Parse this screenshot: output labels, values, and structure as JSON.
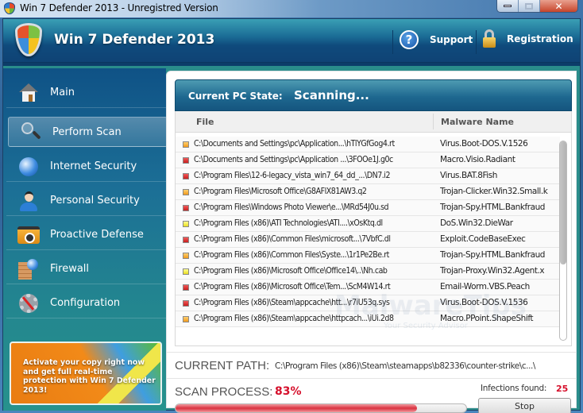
{
  "window": {
    "title": "Win 7 Defender 2013 - Unregistred Version",
    "controls": {
      "minimize": "—",
      "maximize": "□",
      "close": "✕"
    }
  },
  "header": {
    "app_title": "Win 7 Defender 2013",
    "support_label": "Support",
    "registration_label": "Registration",
    "icons": {
      "logo": "shield-icon",
      "support": "help-icon",
      "registration": "lock-icon"
    }
  },
  "sidebar": {
    "items": [
      {
        "label": "Main",
        "icon": "house-icon",
        "active": false
      },
      {
        "label": "Perform Scan",
        "icon": "magnifier-icon",
        "active": true
      },
      {
        "label": "Internet Security",
        "icon": "globe-icon",
        "active": false
      },
      {
        "label": "Personal Security",
        "icon": "person-icon",
        "active": false
      },
      {
        "label": "Proactive Defense",
        "icon": "folder-icon",
        "active": false
      },
      {
        "label": "Firewall",
        "icon": "firewall-icon",
        "active": false
      },
      {
        "label": "Configuration",
        "icon": "gear-icon",
        "active": false
      }
    ],
    "promo_text": "Activate your copy right now and get full real-time protection with Win 7 Defender 2013!"
  },
  "main": {
    "state_label": "Current PC State:",
    "state_value": "Scanning...",
    "columns": {
      "file": "File",
      "malware": "Malware Name"
    },
    "rows": [
      {
        "severity": "orange",
        "file": "C:\\Documents and Settings\\pc\\Application...\\hTlYGfGog4.rt",
        "malware": "Virus.Boot-DOS.V.1526"
      },
      {
        "severity": "red",
        "file": "C:\\Documents and Settings\\pc\\Application ...\\3FOOe1J.g0c",
        "malware": "Macro.Visio.Radiant"
      },
      {
        "severity": "red",
        "file": "C:\\Program Files\\12-6-legacy_vista_win7_64_dd_...\\DN7.i2",
        "malware": "Virus.BAT.8Fish"
      },
      {
        "severity": "orange",
        "file": "C:\\Program Files\\Microsoft Office\\G8AFlX81AW3.q2",
        "malware": "Trojan-Clicker.Win32.Small.k"
      },
      {
        "severity": "red",
        "file": "C:\\Program Files\\Windows Photo Viewer\\e...\\MRd54J0u.sd",
        "malware": "Trojan-Spy.HTML.Bankfraud"
      },
      {
        "severity": "yellow",
        "file": "C:\\Program Files (x86)\\ATI Technologies\\ATI....\\xOsKtq.dl",
        "malware": "DoS.Win32.DieWar"
      },
      {
        "severity": "red",
        "file": "C:\\Program Files (x86)\\Common Files\\microsoft...\\7VbfC.dl",
        "malware": "Exploit.CodeBaseExec"
      },
      {
        "severity": "orange",
        "file": "C:\\Program Files (x86)\\Common Files\\Syste...\\1r1Pe2Be.rt",
        "malware": "Trojan-Spy.HTML.Bankfraud"
      },
      {
        "severity": "yellow",
        "file": "C:\\Program Files (x86)\\Microsoft Office\\Office14\\..\\Nh.cab",
        "malware": "Trojan-Proxy.Win32.Agent.x"
      },
      {
        "severity": "red",
        "file": "C:\\Program Files (x86)\\Microsoft Office\\Tem...\\ScM4W14.rt",
        "malware": "Email-Worm.VBS.Peach"
      },
      {
        "severity": "red",
        "file": "C:\\Program Files (x86)\\Steam\\appcache\\htt...\\r7iU53q.sys",
        "malware": "Virus.Boot-DOS.V.1536"
      },
      {
        "severity": "orange",
        "file": "C:\\Program Files (x86)\\Steam\\appcache\\httpcach...\\iUi.2d8",
        "malware": "Macro.PPoint.ShapeShift"
      }
    ],
    "watermark": "MalwareTips",
    "watermark_sub": "Your Security Advisor",
    "current_path_label": "CURRENT PATH:",
    "current_path_value": "C:\\Program Files (x86)\\Steam\\steamapps\\b82336\\counter-strike\\c...\\",
    "scan_process_label": "SCAN PROCESS:",
    "scan_percent_text": "83%",
    "scan_progress": 0.83,
    "infections_label": "Infections found:",
    "infections_count": "25",
    "stop_label": "Stop",
    "colors": {
      "accent_red": "#d6102c",
      "severity_red": "#d82828",
      "severity_orange": "#f0a020",
      "severity_yellow": "#ecdf2a"
    }
  }
}
